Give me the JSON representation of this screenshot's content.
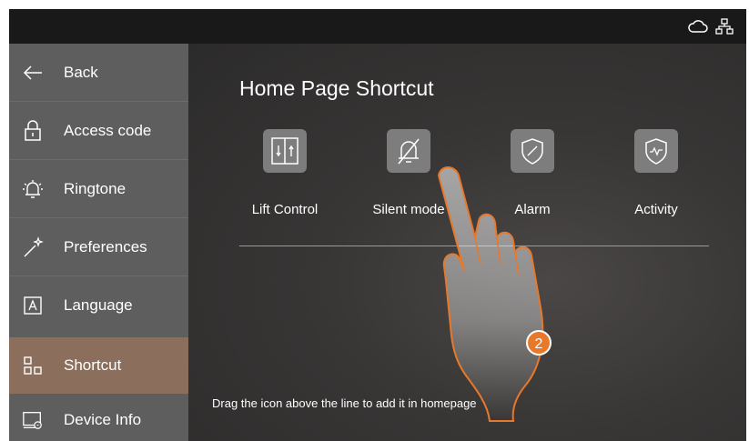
{
  "status_bar": {
    "icons": [
      "cloud-icon",
      "network-icon"
    ]
  },
  "sidebar": {
    "items": [
      {
        "label": "Back",
        "icon": "arrow-left-icon",
        "active": false
      },
      {
        "label": "Access code",
        "icon": "lock-icon",
        "active": false
      },
      {
        "label": "Ringtone",
        "icon": "bell-icon",
        "active": false
      },
      {
        "label": "Preferences",
        "icon": "magic-wand-icon",
        "active": false
      },
      {
        "label": "Language",
        "icon": "language-icon",
        "active": false
      },
      {
        "label": "Shortcut",
        "icon": "shortcut-grid-icon",
        "active": true
      },
      {
        "label": "Device Info",
        "icon": "device-info-icon",
        "active": false
      }
    ],
    "active_color": "#8c6e5c"
  },
  "main": {
    "title": "Home Page Shortcut",
    "shortcuts": [
      {
        "label": "Lift Control",
        "icon": "lift-icon"
      },
      {
        "label": "Silent mode",
        "icon": "bell-off-icon"
      },
      {
        "label": "Alarm",
        "icon": "shield-icon"
      },
      {
        "label": "Activity",
        "icon": "activity-shield-icon"
      }
    ],
    "hint": "Drag the icon above the line to add it in homepage"
  },
  "overlay": {
    "step_number": "2",
    "accent": "#e8782a"
  }
}
